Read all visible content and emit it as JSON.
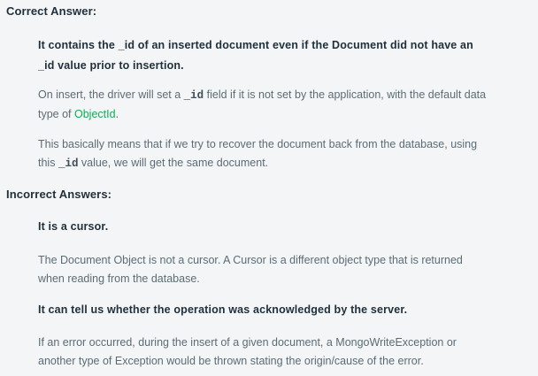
{
  "correct": {
    "heading": "Correct Answer:",
    "answer": "It contains the _id of an inserted document even if the Document did not have an _id value prior to insertion.",
    "explanation1": {
      "text_before_code": "On insert, the driver will set a ",
      "code": "_id",
      "text_after_code": " field if it is not set by the application, with the default data type of ",
      "link": "ObjectId",
      "text_end": "."
    },
    "explanation2": {
      "text_before_code": "This basically means that if we try to recover the document back from the database, using this ",
      "code": "_id",
      "text_after_code": " value, we will get the same document."
    }
  },
  "incorrect": {
    "heading": "Incorrect Answers:",
    "items": [
      {
        "answer": "It is a cursor.",
        "explanation": "The Document Object is not a cursor. A Cursor is a different object type that is returned when reading from the database."
      },
      {
        "answer": "It can tell us whether the operation was acknowledged by the server.",
        "explanation": "If an error occurred, during the insert of a given document, a MongoWriteException or another type of Exception would be thrown stating the origin/cause of the error."
      }
    ]
  },
  "colors": {
    "background": "#f4f5f6",
    "heading": "#21313c",
    "body_text": "#5c6c75",
    "link": "#13aa52"
  }
}
